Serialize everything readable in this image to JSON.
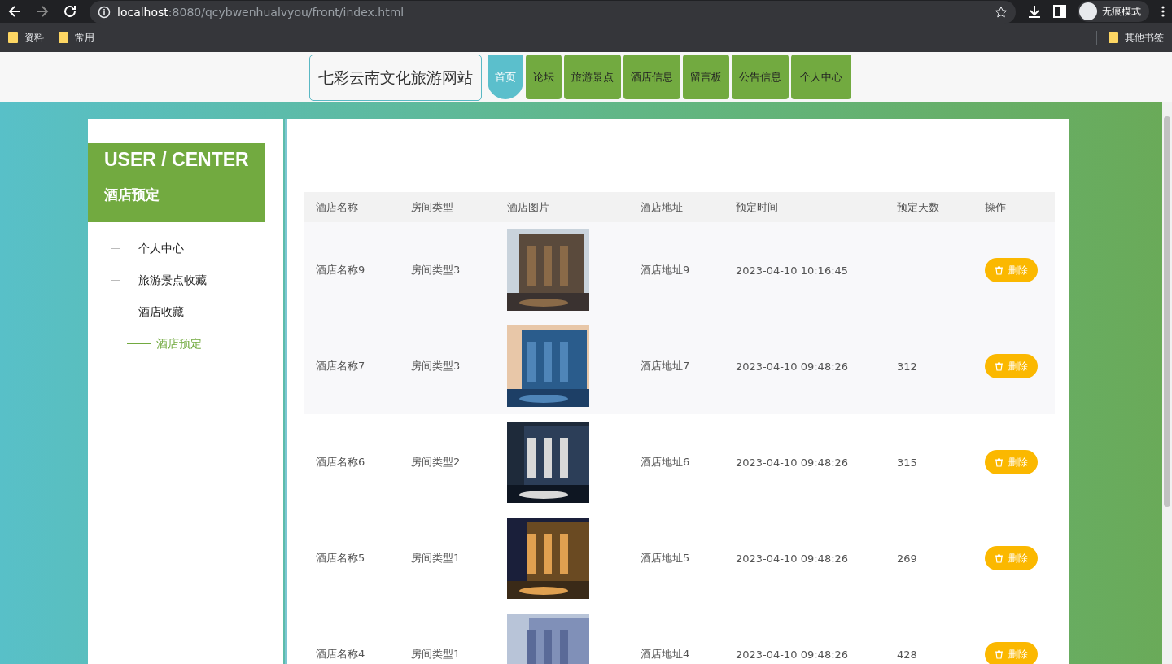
{
  "browser": {
    "url_host": "localhost",
    "url_rest": ":8080/qcybwenhualvyou/front/index.html",
    "profile": "无痕模式",
    "bookmarks": [
      "资料",
      "常用"
    ],
    "other_bookmarks": "其他书签"
  },
  "nav": {
    "brand": "七彩云南文化旅游网站",
    "items": [
      {
        "label": "首页",
        "selected": true
      },
      {
        "label": "论坛",
        "selected": false
      },
      {
        "label": "旅游景点",
        "selected": false
      },
      {
        "label": "酒店信息",
        "selected": false
      },
      {
        "label": "留言板",
        "selected": false
      },
      {
        "label": "公告信息",
        "selected": false
      },
      {
        "label": "个人中心",
        "selected": false
      }
    ]
  },
  "sidebar": {
    "title": "USER / CENTER",
    "subtitle": "酒店预定",
    "items": [
      {
        "label": "个人中心",
        "selected": false
      },
      {
        "label": "旅游景点收藏",
        "selected": false
      },
      {
        "label": "酒店收藏",
        "selected": false
      },
      {
        "label": "酒店预定",
        "selected": true
      }
    ]
  },
  "table": {
    "columns": [
      "酒店名称",
      "房间类型",
      "酒店图片",
      "酒店地址",
      "预定时间",
      "预定天数",
      "操作"
    ],
    "rows": [
      {
        "name": "酒店名称9",
        "room": "房间类型3",
        "address": "酒店地址9",
        "time": "2023-04-10 10:16:45",
        "action": "删除"
      },
      {
        "name": "酒店名称7",
        "room": "房间类型3",
        "address": "酒店地址7",
        "time": "2023-04-10 09:48:26",
        "days": "312",
        "action": "删除"
      },
      {
        "name": "酒店名称6",
        "room": "房间类型2",
        "address": "酒店地址6",
        "time": "2023-04-10 09:48:26",
        "days": "315",
        "action": "删除"
      },
      {
        "name": "酒店名称5",
        "room": "房间类型1",
        "address": "酒店地址5",
        "time": "2023-04-10 09:48:26",
        "days": "269",
        "action": "删除"
      },
      {
        "name": "酒店名称4",
        "room": "房间类型1",
        "address": "酒店地址4",
        "time": "2023-04-10 09:48:26",
        "days": "428",
        "action": "删除"
      }
    ]
  }
}
